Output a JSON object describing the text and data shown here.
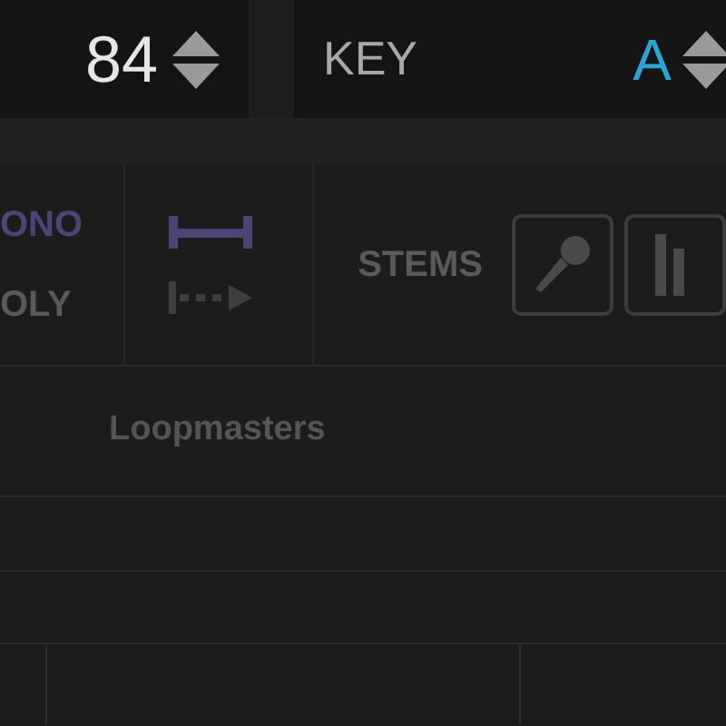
{
  "tempo": {
    "value": "84"
  },
  "key": {
    "label": "KEY",
    "value": "A"
  },
  "voice_modes": [
    {
      "label": "ONO",
      "selected": true
    },
    {
      "label": "OLY",
      "selected": false
    }
  ],
  "play_modes": [
    {
      "kind": "range",
      "selected": true
    },
    {
      "kind": "arrow",
      "selected": false
    }
  ],
  "stems": {
    "label": "STEMS",
    "buttons": [
      {
        "kind": "mic"
      },
      {
        "kind": "bars"
      }
    ]
  },
  "library": {
    "label": "Loopmasters"
  }
}
